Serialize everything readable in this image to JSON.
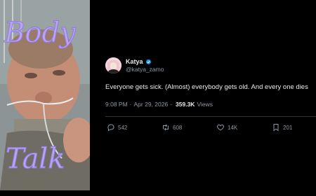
{
  "tweet": {
    "author_name": "Katya",
    "handle": "@katya_zamo",
    "text": "Everyone gets sick. (Almost) everybody gets old.  And every one dies",
    "time": "9:08 PM",
    "date": "Apr 29, 2026",
    "views": "359.3K",
    "views_label": "Views",
    "separator": "·",
    "replies": "542",
    "retweets": "608",
    "likes": "14K",
    "bookmarks": "201"
  },
  "photo": {
    "overlay_text_top": "Body",
    "overlay_text_bottom": "Talk"
  },
  "colors": {
    "background": "#000000",
    "text_primary": "#e7e9ea",
    "text_secondary": "#8b98a5",
    "verified": "#1d9bf0",
    "overlay_script": "#b9a4f0"
  },
  "icons": {
    "verified": "verified-badge-icon",
    "reply": "reply-icon",
    "retweet": "retweet-icon",
    "like": "heart-icon",
    "bookmark": "bookmark-icon"
  }
}
